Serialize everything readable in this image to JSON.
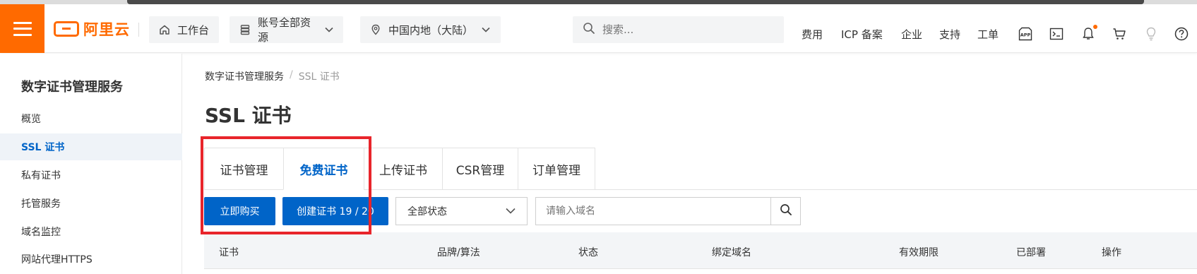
{
  "topbar": {
    "logo_text": "阿里云",
    "workbench": "工作台",
    "resources": "账号全部资源",
    "region": "中国内地（大陆）",
    "search_placeholder": "搜索...",
    "links": {
      "fees": "费用",
      "icp": "ICP 备案",
      "enterprise": "企业",
      "support": "支持",
      "ticket": "工单"
    }
  },
  "sidebar": {
    "title": "数字证书管理服务",
    "items": [
      {
        "label": "概览"
      },
      {
        "label": "SSL 证书"
      },
      {
        "label": "私有证书"
      },
      {
        "label": "托管服务"
      },
      {
        "label": "域名监控"
      },
      {
        "label": "网站代理HTTPS"
      }
    ]
  },
  "breadcrumb": {
    "root": "数字证书管理服务",
    "current": "SSL 证书"
  },
  "page_title": "SSL 证书",
  "tabs": [
    {
      "label": "证书管理"
    },
    {
      "label": "免费证书"
    },
    {
      "label": "上传证书"
    },
    {
      "label": "CSR管理"
    },
    {
      "label": "订单管理"
    }
  ],
  "toolbar": {
    "buy_now": "立即购买",
    "create_cert": "创建证书 19 / 20",
    "status_select": "全部状态",
    "domain_placeholder": "请输入域名"
  },
  "table": {
    "columns": [
      "证书",
      "品牌/算法",
      "状态",
      "绑定域名",
      "有效期限",
      "已部署",
      "操作"
    ]
  },
  "colors": {
    "brand_orange": "#ff6a00",
    "primary_blue": "#0064c8",
    "highlight_red": "#e8252b"
  }
}
